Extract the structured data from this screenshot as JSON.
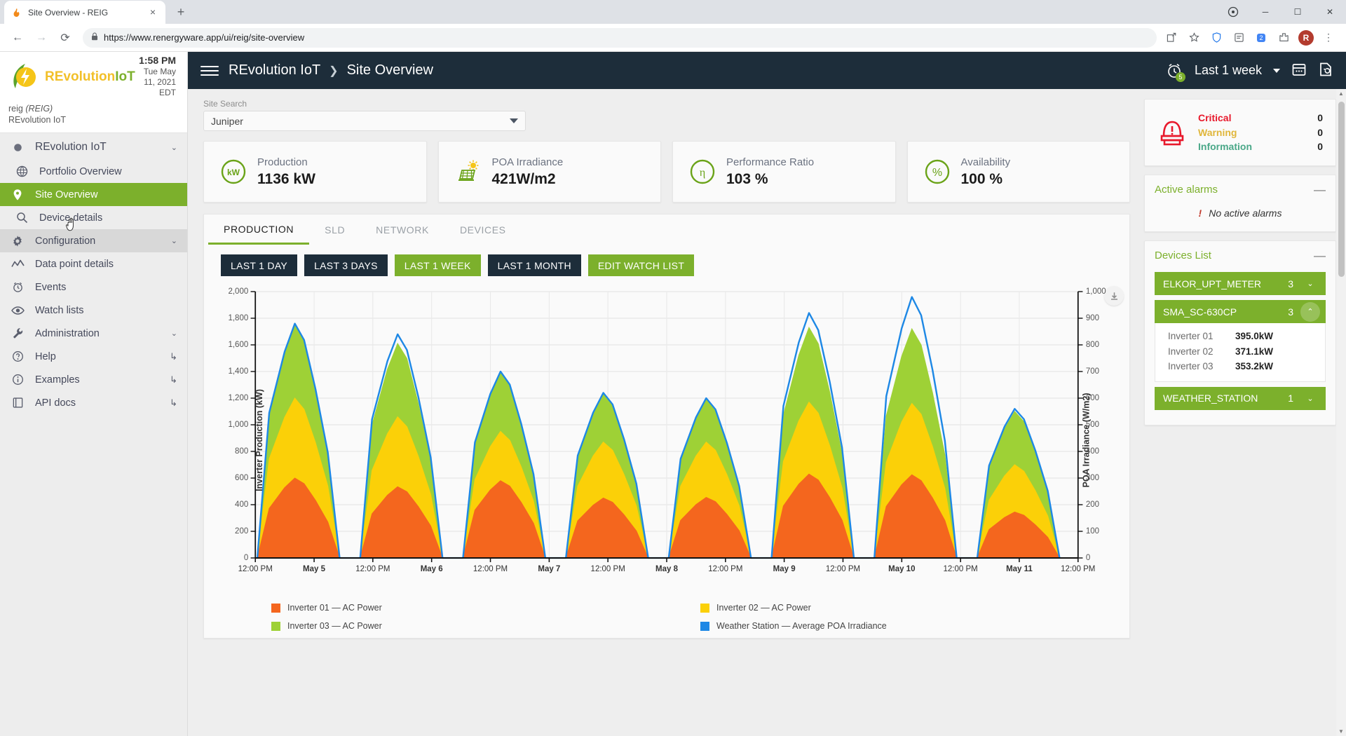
{
  "browser": {
    "tab_title": "Site Overview - REIG",
    "favicon": "flame-icon",
    "new_tab": "+",
    "close": "×",
    "url": "https://www.renergyware.app/ui/reig/site-overview",
    "lock": "🔒",
    "back": "←",
    "forward": "→",
    "reload": "⟳",
    "win_minimize": "─",
    "win_maximize": "☐",
    "win_close": "✕",
    "profile_initial": "R",
    "menu": "⋮",
    "ext_badge": "2"
  },
  "sidebar": {
    "logo_re": "REvolution",
    "logo_iot": "IoT",
    "clock_time": "1:58 PM",
    "clock_date": "Tue May 11, 2021",
    "clock_tz": "EDT",
    "org_code": "reig",
    "org_abbr": "(REIG)",
    "org_name": "REvolution IoT",
    "items": [
      {
        "label": "REvolution IoT",
        "icon": "dot-icon",
        "state": "root",
        "chevron": "⌄"
      },
      {
        "label": "Portfolio Overview",
        "icon": "globe-icon",
        "state": "sub"
      },
      {
        "label": "Site Overview",
        "icon": "map-pin-icon",
        "state": "active"
      },
      {
        "label": "Device details",
        "icon": "search-icon",
        "state": "sub"
      },
      {
        "label": "Configuration",
        "icon": "gear-icon",
        "state": "hovered",
        "chevron": "⌄"
      },
      {
        "label": "Data point details",
        "icon": "trend-line-icon",
        "state": "normal"
      },
      {
        "label": "Events",
        "icon": "alarm-clock-icon",
        "state": "normal"
      },
      {
        "label": "Watch lists",
        "icon": "eye-icon",
        "state": "normal"
      },
      {
        "label": "Administration",
        "icon": "wrench-icon",
        "state": "normal",
        "chevron": "⌄"
      },
      {
        "label": "Help",
        "icon": "question-circle-icon",
        "state": "normal",
        "external": "↳"
      },
      {
        "label": "Examples",
        "icon": "info-circle-icon",
        "state": "normal",
        "external": "↳"
      },
      {
        "label": "API docs",
        "icon": "book-icon",
        "state": "normal",
        "external": "↳"
      }
    ]
  },
  "topbar": {
    "menu_icon": "hamburger-icon",
    "crumb_root": "REvolution IoT",
    "crumb_sep": "❯",
    "crumb_current": "Site Overview",
    "alarm_badge": "5",
    "range_label": "Last 1 week",
    "calendar_icon": "calendar-icon",
    "history_icon": "history-icon"
  },
  "search": {
    "label": "Site Search",
    "value": "Juniper"
  },
  "kpis": [
    {
      "label": "Production",
      "value": "1136 kW",
      "icon": "kw-gauge-icon",
      "icon_text": "kW"
    },
    {
      "label": "POA Irradiance",
      "value": "421W/m2",
      "icon": "solar-panel-sun-icon"
    },
    {
      "label": "Performance Ratio",
      "value": "103 %",
      "icon": "eta-gauge-icon",
      "icon_text": "η"
    },
    {
      "label": "Availability",
      "value": "100 %",
      "icon": "percent-gauge-icon",
      "icon_text": "%"
    }
  ],
  "alarm_summary": {
    "icon": "alarm-beacon-icon",
    "rows": [
      {
        "name": "Critical",
        "count": "0",
        "color": "#e8192c"
      },
      {
        "name": "Warning",
        "count": "0",
        "color": "#e0b63a"
      },
      {
        "name": "Information",
        "count": "0",
        "color": "#4aa888"
      }
    ]
  },
  "active_alarms": {
    "title": "Active alarms",
    "collapse": "—",
    "empty_icon": "exclamation-icon",
    "empty_text": "No active alarms"
  },
  "devices_list": {
    "title": "Devices List",
    "collapse": "—",
    "groups": [
      {
        "name": "ELKOR_UPT_METER",
        "count": "3",
        "expanded": false,
        "chevron": "⌄",
        "devices": []
      },
      {
        "name": "SMA_SC-630CP",
        "count": "3",
        "expanded": true,
        "chevron": "⌃",
        "devices": [
          {
            "name": "Inverter 01",
            "value": "395.0kW"
          },
          {
            "name": "Inverter 02",
            "value": "371.1kW"
          },
          {
            "name": "Inverter 03",
            "value": "353.2kW"
          }
        ]
      },
      {
        "name": "WEATHER_STATION",
        "count": "1",
        "expanded": false,
        "chevron": "⌄",
        "devices": []
      }
    ]
  },
  "tabs": [
    {
      "label": "PRODUCTION",
      "active": true
    },
    {
      "label": "SLD",
      "active": false
    },
    {
      "label": "NETWORK",
      "active": false
    },
    {
      "label": "DEVICES",
      "active": false
    }
  ],
  "range_buttons": [
    {
      "label": "LAST 1 DAY",
      "active": false
    },
    {
      "label": "LAST 3 DAYS",
      "active": false
    },
    {
      "label": "LAST 1 WEEK",
      "active": true
    },
    {
      "label": "LAST 1 MONTH",
      "active": false
    },
    {
      "label": "EDIT WATCH LIST",
      "active": true
    }
  ],
  "chart_download_icon": "download-icon",
  "chart_data": {
    "type": "area",
    "title": "",
    "xlabel": "",
    "ylabel": "Inverter Production (kW)",
    "y2label": "POA Irradiance (W/m2)",
    "ylim": [
      0,
      2000
    ],
    "y2lim": [
      0,
      1000
    ],
    "grid": true,
    "legend_position": "bottom",
    "yticks": [
      "0",
      "200",
      "400",
      "600",
      "800",
      "1,000",
      "1,200",
      "1,400",
      "1,600",
      "1,800",
      "2,000"
    ],
    "y2ticks": [
      "0",
      "100",
      "200",
      "300",
      "400",
      "500",
      "600",
      "700",
      "800",
      "900",
      "1,000"
    ],
    "xticks": [
      "12:00 PM",
      "May 5",
      "12:00 PM",
      "May 6",
      "12:00 PM",
      "May 7",
      "12:00 PM",
      "May 8",
      "12:00 PM",
      "May 9",
      "12:00 PM",
      "May 10",
      "12:00 PM",
      "May 11",
      "12:00 PM"
    ],
    "legend": [
      {
        "name": "Inverter 01 — AC Power",
        "color": "#f4661e"
      },
      {
        "name": "Inverter 02 — AC Power",
        "color": "#fbd008"
      },
      {
        "name": "Inverter 03 — AC Power",
        "color": "#9ed136"
      },
      {
        "name": "Weather Station — Average POA Irradiance",
        "color": "#1e88e5"
      }
    ],
    "series": [
      {
        "name": "Inverter 01 — AC Power",
        "color": "#f4661e",
        "stacked": true,
        "peaks": [
          600,
          535,
          580,
          450,
          455,
          630,
          625,
          345
        ]
      },
      {
        "name": "Inverter 02 — AC Power",
        "color": "#fbd008",
        "stacked": true,
        "peaks": [
          1200,
          1060,
          950,
          870,
          870,
          1170,
          1160,
          700
        ]
      },
      {
        "name": "Inverter 03 — AC Power",
        "color": "#9ed136",
        "stacked": true,
        "peaks": [
          1760,
          1610,
          1390,
          1230,
          1200,
          1730,
          1720,
          1100
        ]
      },
      {
        "name": "Weather Station — Average POA Irradiance",
        "color": "#1e88e5",
        "axis": "right",
        "peaks": [
          880,
          840,
          700,
          620,
          600,
          920,
          980,
          560
        ]
      }
    ]
  }
}
